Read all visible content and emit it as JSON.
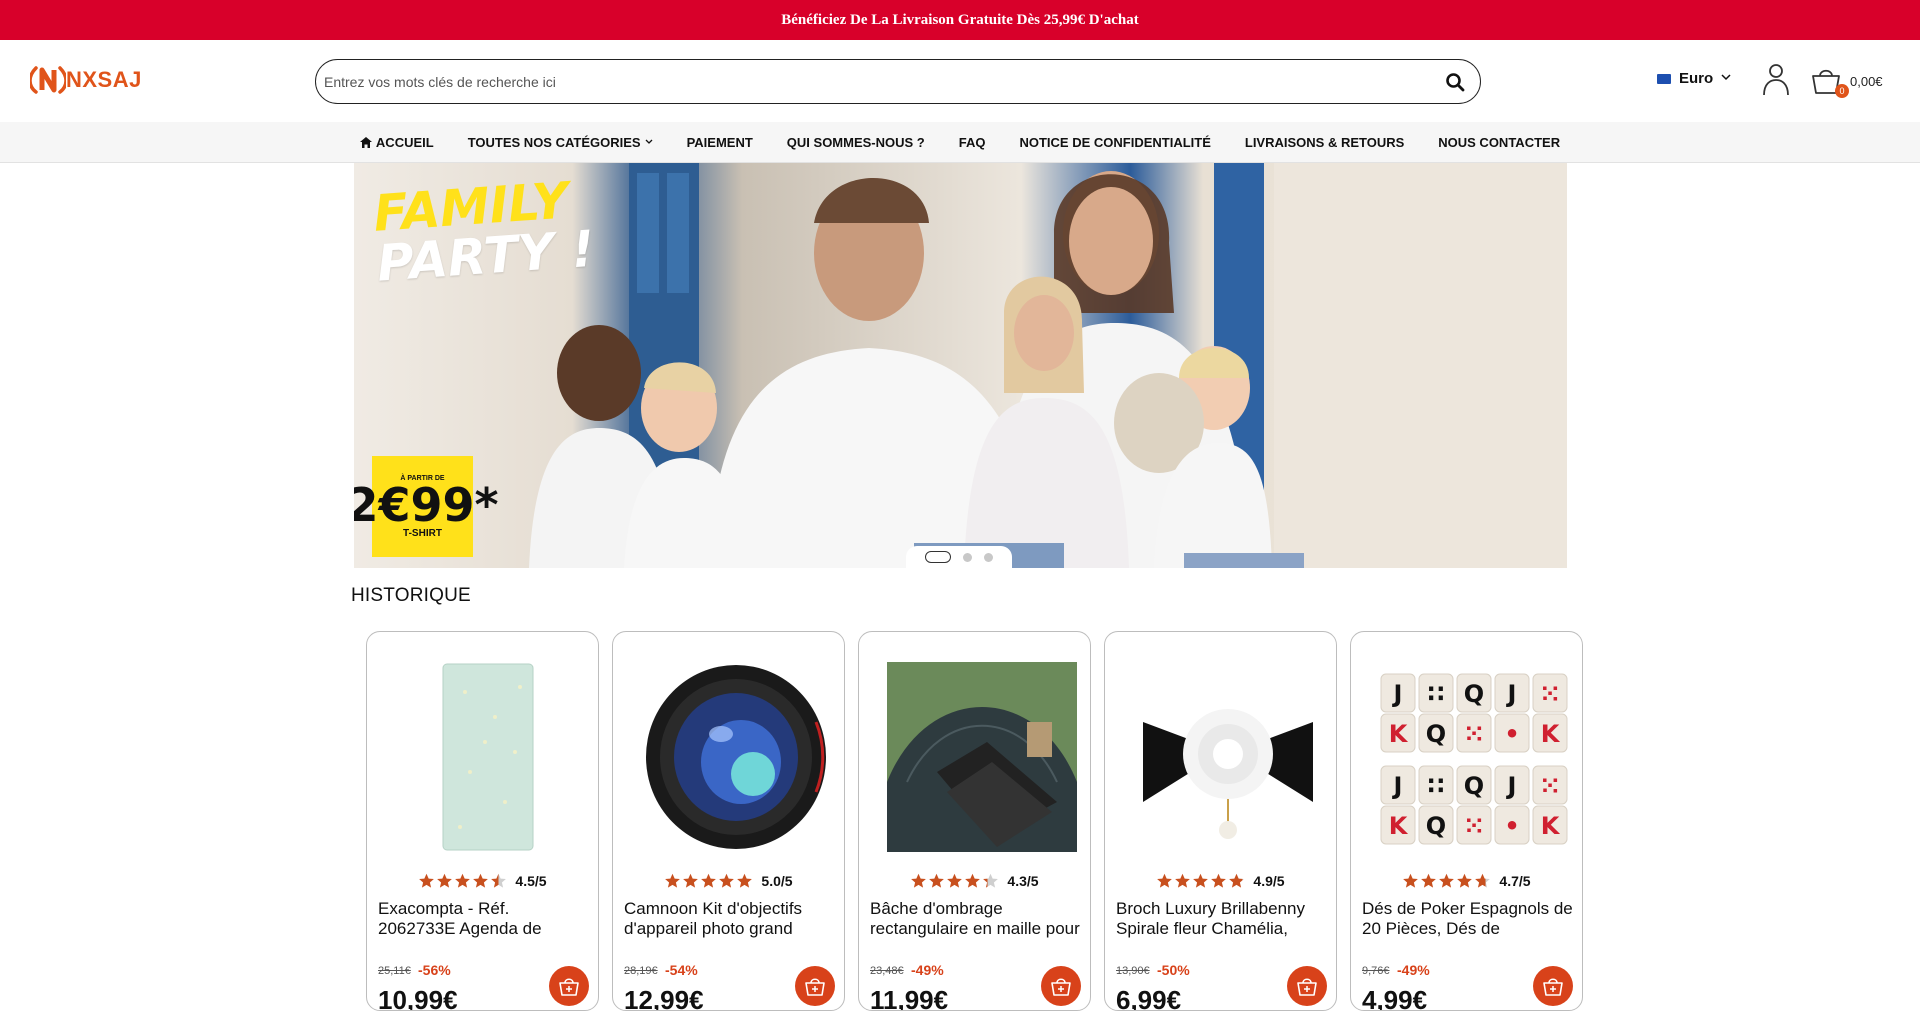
{
  "promo": {
    "text": "Bénéficiez De La Livraison Gratuite Dès 25,99€ D'achat"
  },
  "header": {
    "logo_text": "NXSAJ",
    "search_placeholder": "Entrez vos mots clés de recherche ici",
    "currency_label": "Euro",
    "cart_count": "0",
    "cart_total": "0,00€"
  },
  "nav": {
    "items": [
      {
        "label": "ACCUEIL",
        "icon": "home-icon"
      },
      {
        "label": "TOUTES NOS CATÉGORIES",
        "icon": "chevron-down-icon"
      },
      {
        "label": "PAIEMENT"
      },
      {
        "label": "QUI SOMMES-NOUS ?"
      },
      {
        "label": "FAQ"
      },
      {
        "label": "NOTICE DE CONFIDENTIALITÉ"
      },
      {
        "label": "LIVRAISONS & RETOURS"
      },
      {
        "label": "NOUS CONTACTER"
      }
    ]
  },
  "hero": {
    "title_line1": "FAMILY",
    "title_line2": "PARTY !",
    "price_from": "À PARTIR DE",
    "price_amount": "2€99*",
    "price_item": "T-SHIRT",
    "slides": 3,
    "active_slide": 1
  },
  "section": {
    "title": "HISTORIQUE"
  },
  "products": [
    {
      "rating": 4.5,
      "rating_label": "4.5/5",
      "title": "Exacompta - Réf. 2062733E Agenda de",
      "old_price": "25,11€",
      "discount": "-56%",
      "price": "10,99€",
      "image": "planner-image"
    },
    {
      "rating": 5.0,
      "rating_label": "5.0/5",
      "title": "Camnoon Kit d'objectifs d'appareil photo grand",
      "old_price": "28,19€",
      "discount": "-54%",
      "price": "12,99€",
      "image": "camera-lens-image"
    },
    {
      "rating": 4.3,
      "rating_label": "4.3/5",
      "title": "Bâche d'ombrage rectangulaire en maille pour",
      "old_price": "23,48€",
      "discount": "-49%",
      "price": "11,99€",
      "image": "shade-net-image"
    },
    {
      "rating": 4.9,
      "rating_label": "4.9/5",
      "title": "Broch Luxury Brillabenny Spirale fleur Chamélia,",
      "old_price": "13,90€",
      "discount": "-50%",
      "price": "6,99€",
      "image": "camellia-brooch-image"
    },
    {
      "rating": 4.7,
      "rating_label": "4.7/5",
      "title": "Dés de Poker Espagnols de 20 Pièces, Dés de",
      "old_price": "9,76€",
      "discount": "-49%",
      "price": "4,99€",
      "image": "poker-dice-image"
    }
  ],
  "colors": {
    "promo_bg": "#d8002a",
    "accent": "#d8421a",
    "star": "#c8501e"
  }
}
